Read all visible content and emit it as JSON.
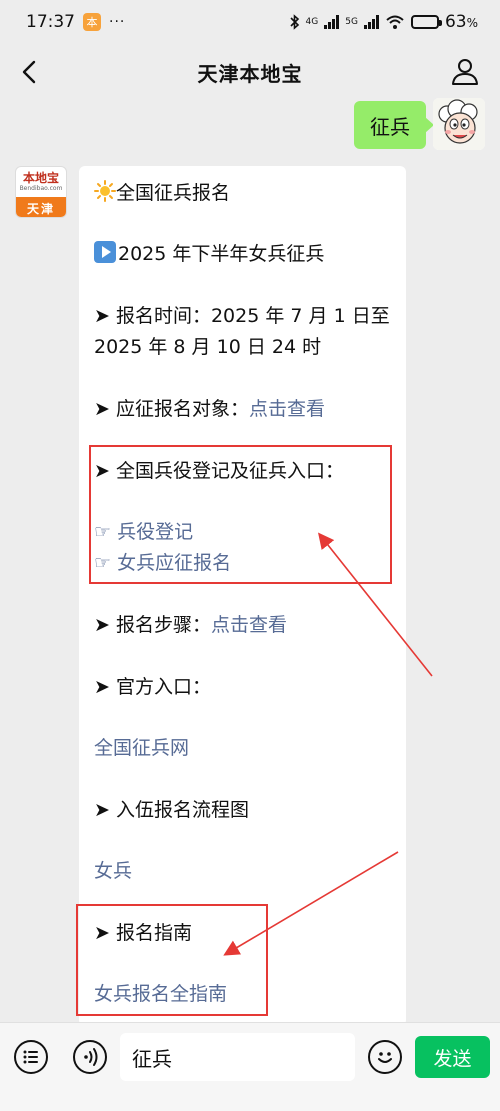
{
  "status_bar": {
    "time": "17:37",
    "app_badge": "本",
    "more": "···",
    "network_1": "4G",
    "network_2": "5G",
    "battery_percent": "63",
    "battery_unit": "%",
    "battery_level": 0.63
  },
  "nav": {
    "title": "天津本地宝"
  },
  "sent_message": {
    "text": "征兵"
  },
  "bot_avatar": {
    "top_text": "本地宝",
    "sub_text": "Bendibao.com",
    "bottom_text": "天津"
  },
  "message": {
    "title": "全国征兵报名",
    "subtitle": "2025 年下半年女兵征兵",
    "time_label": "➤ 报名时间：",
    "time_line1_value": "2025 年 7 月 1 日至",
    "time_line2": "2025 年 8 月 10 日 24 时",
    "target_label": "➤ 应征报名对象：",
    "target_link": "点击查看",
    "entry_title": "➤ 全国兵役登记及征兵入口：",
    "hand_icon": "☞",
    "entry_link1": "兵役登记",
    "entry_link2": "女兵应征报名",
    "steps_label": "➤ 报名步骤：",
    "steps_link": "点击查看",
    "official_title": "➤ 官方入口：",
    "official_link": "全国征兵网",
    "flow_title": "➤ 入伍报名流程图",
    "flow_link": "女兵",
    "guide_title": "➤ 报名指南",
    "guide_link": "女兵报名全指南"
  },
  "input_bar": {
    "value": "征兵",
    "send_label": "发送"
  },
  "colors": {
    "accent_green": "#07c160",
    "bubble_green": "#95ec69",
    "link_blue": "#576b95",
    "annotation_red": "#e53935"
  }
}
